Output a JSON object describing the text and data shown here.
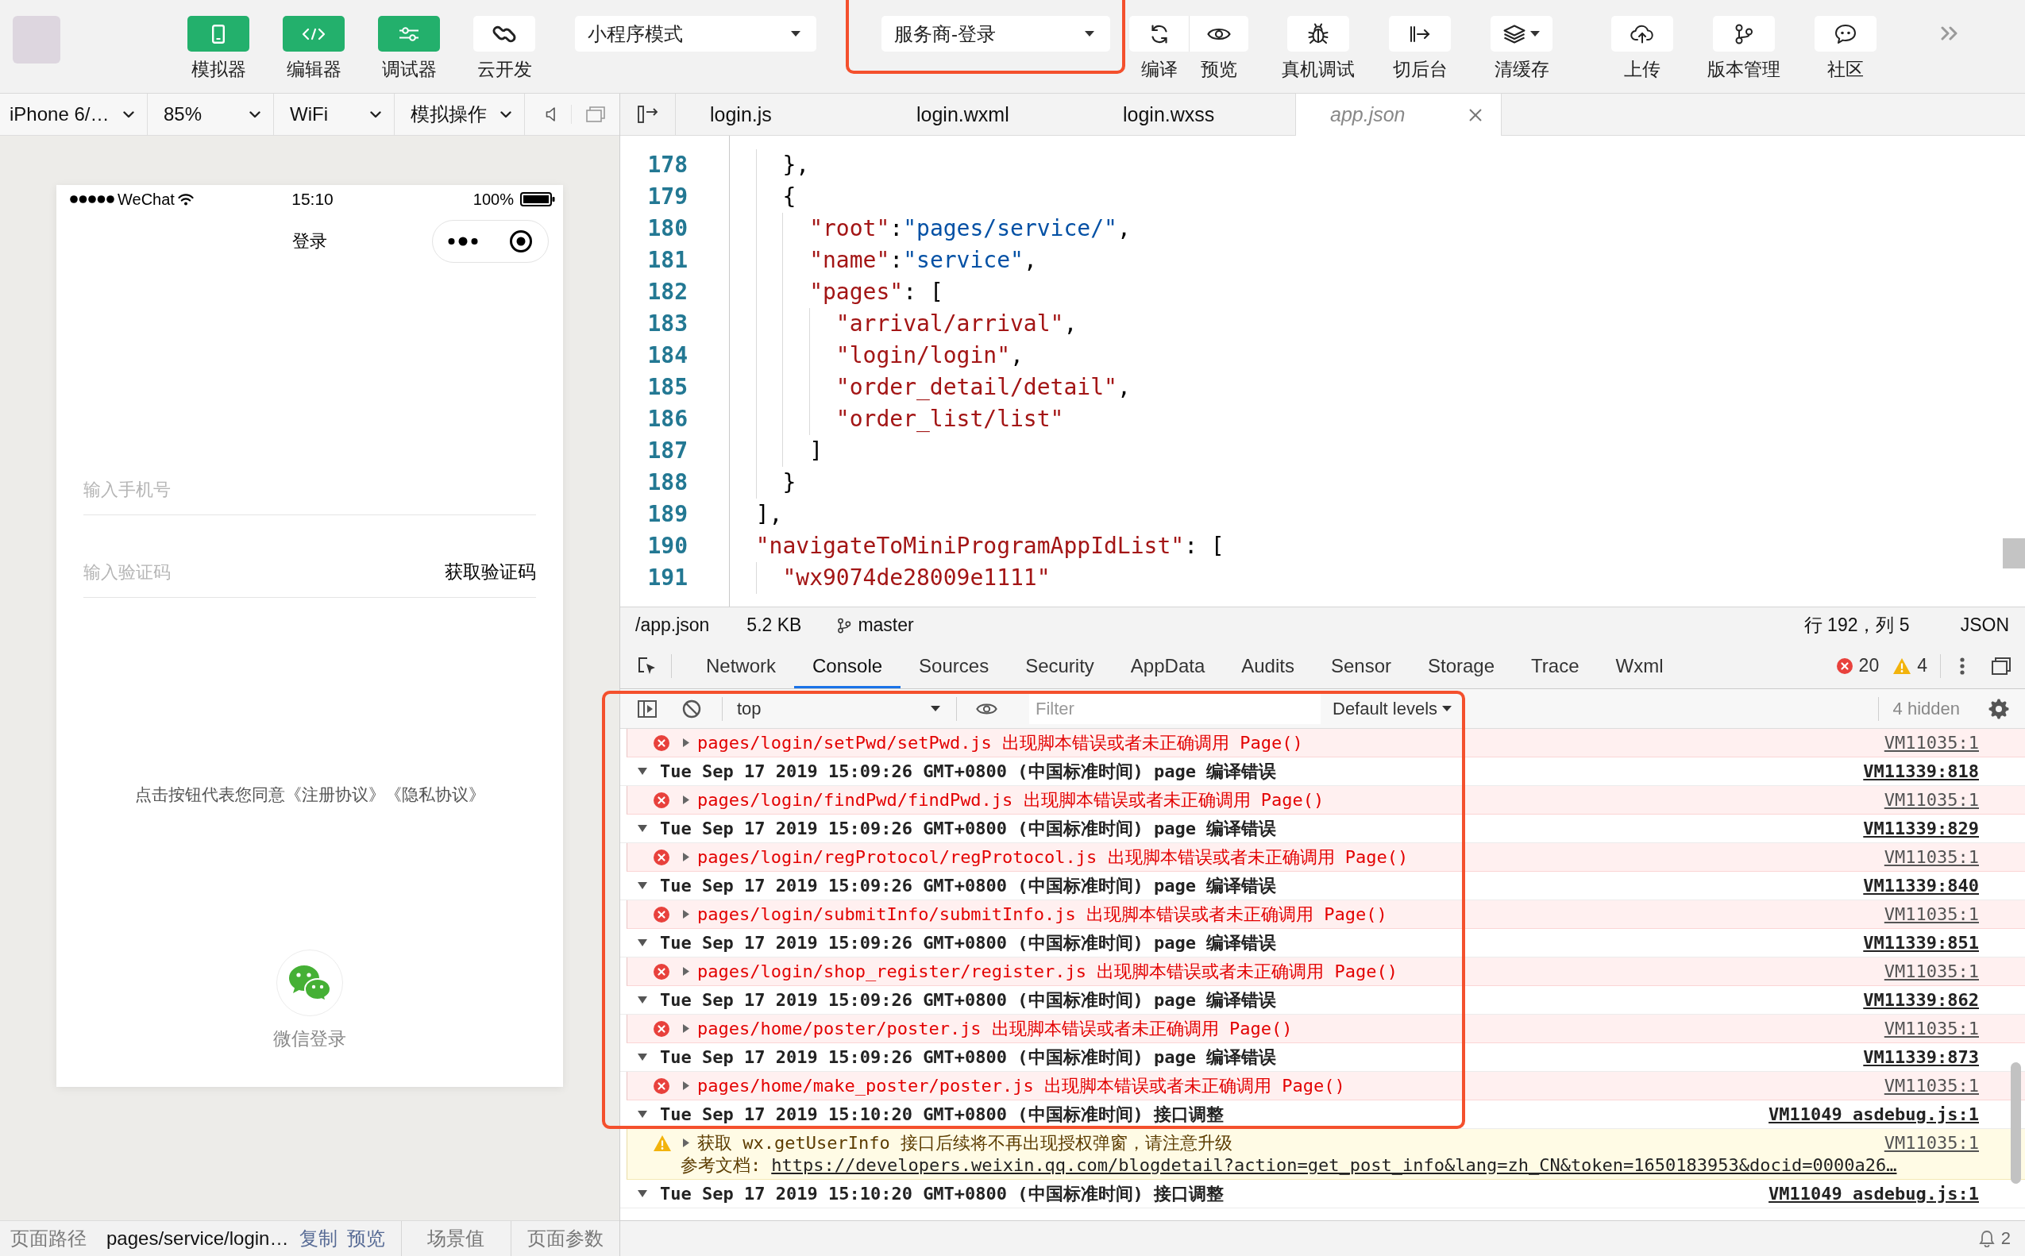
{
  "toolbar": {
    "panels": [
      {
        "label": "模拟器",
        "kind": "phone",
        "on": true
      },
      {
        "label": "编辑器",
        "kind": "code",
        "on": true
      },
      {
        "label": "调试器",
        "kind": "debug",
        "on": true
      },
      {
        "label": "云开发",
        "kind": "cloud",
        "on": false
      }
    ],
    "mode_select": {
      "value": "小程序模式"
    },
    "compile_select": {
      "value": "服务商-登录",
      "highlighted": true
    },
    "action_groups": [
      {
        "joined": true,
        "items": [
          {
            "label": "编译",
            "kind": "compile",
            "menu": false
          },
          {
            "label": "预览",
            "kind": "preview",
            "menu": false
          }
        ]
      },
      {
        "joined": false,
        "items": [
          {
            "label": "真机调试",
            "kind": "remote_debug",
            "menu": false
          },
          {
            "label": "切后台",
            "kind": "background",
            "menu": false
          },
          {
            "label": "清缓存",
            "kind": "clear_cache",
            "menu": true
          }
        ]
      },
      {
        "joined": false,
        "items": [
          {
            "label": "上传",
            "kind": "upload",
            "menu": false
          },
          {
            "label": "版本管理",
            "kind": "version",
            "menu": false
          },
          {
            "label": "社区",
            "kind": "community",
            "menu": false
          }
        ]
      }
    ]
  },
  "simulator": {
    "toolbar": {
      "device": "iPhone 6/…",
      "zoom": "85%",
      "network": "WiFi",
      "operation": "模拟操作"
    },
    "phone": {
      "status_bar": {
        "carrier": "WeChat",
        "time": "15:10",
        "battery": "100%"
      },
      "title": "登录",
      "fields": [
        {
          "placeholder": "输入手机号"
        },
        {
          "placeholder": "输入验证码",
          "action": "获取验证码"
        }
      ],
      "agreement": "点击按钮代表您同意《注册协议》《隐私协议》",
      "wechat_login": "微信登录"
    },
    "status_bar": {
      "path_label": "页面路径",
      "path": "pages/service/login…",
      "copy": "复制",
      "preview": "预览",
      "scene": "场景值",
      "params": "页面参数"
    }
  },
  "editor": {
    "tabs": [
      {
        "label": "login.js",
        "selected": false,
        "preview": false
      },
      {
        "label": "login.wxml",
        "selected": false,
        "preview": false
      },
      {
        "label": "login.wxss",
        "selected": false,
        "preview": false
      },
      {
        "label": "app.json",
        "selected": true,
        "preview": true
      }
    ],
    "lines": [
      {
        "number": "178",
        "tokens": [
          {
            "kind": "punct",
            "text": "    },"
          }
        ]
      },
      {
        "number": "179",
        "tokens": [
          {
            "kind": "punct",
            "text": "    {"
          }
        ]
      },
      {
        "number": "180",
        "tokens": [
          {
            "kind": "key",
            "text": "      \"root\""
          },
          {
            "kind": "punct",
            "text": ":"
          },
          {
            "kind": "value",
            "text": "\"pages/service/\""
          },
          {
            "kind": "punct",
            "text": ","
          }
        ]
      },
      {
        "number": "181",
        "tokens": [
          {
            "kind": "key",
            "text": "      \"name\""
          },
          {
            "kind": "punct",
            "text": ":"
          },
          {
            "kind": "value",
            "text": "\"service\""
          },
          {
            "kind": "punct",
            "text": ","
          }
        ]
      },
      {
        "number": "182",
        "tokens": [
          {
            "kind": "key",
            "text": "      \"pages\""
          },
          {
            "kind": "punct",
            "text": ": ["
          }
        ]
      },
      {
        "number": "183",
        "tokens": [
          {
            "kind": "element",
            "text": "        \"arrival/arrival\""
          },
          {
            "kind": "punct",
            "text": ","
          }
        ]
      },
      {
        "number": "184",
        "tokens": [
          {
            "kind": "element",
            "text": "        \"login/login\""
          },
          {
            "kind": "punct",
            "text": ","
          }
        ]
      },
      {
        "number": "185",
        "tokens": [
          {
            "kind": "element",
            "text": "        \"order_detail/detail\""
          },
          {
            "kind": "punct",
            "text": ","
          }
        ]
      },
      {
        "number": "186",
        "tokens": [
          {
            "kind": "element",
            "text": "        \"order_list/list\""
          }
        ]
      },
      {
        "number": "187",
        "tokens": [
          {
            "kind": "punct",
            "text": "      ]"
          }
        ]
      },
      {
        "number": "188",
        "tokens": [
          {
            "kind": "punct",
            "text": "    }"
          }
        ]
      },
      {
        "number": "189",
        "tokens": [
          {
            "kind": "punct",
            "text": "  ],"
          }
        ]
      },
      {
        "number": "190",
        "tokens": [
          {
            "kind": "key",
            "text": "  \"navigateToMiniProgramAppIdList\""
          },
          {
            "kind": "punct",
            "text": ": ["
          }
        ]
      },
      {
        "number": "191",
        "tokens": [
          {
            "kind": "element",
            "text": "    \"wx9074de28009e1111\""
          }
        ]
      }
    ],
    "status_bar": {
      "path": "/app.json",
      "size": "5.2 KB",
      "branch": "master",
      "cursor": "行 192，列 5",
      "language": "JSON"
    }
  },
  "devtools": {
    "tabs": [
      {
        "label": "Network",
        "selected": false
      },
      {
        "label": "Console",
        "selected": true
      },
      {
        "label": "Sources",
        "selected": false
      },
      {
        "label": "Security",
        "selected": false
      },
      {
        "label": "AppData",
        "selected": false
      },
      {
        "label": "Audits",
        "selected": false
      },
      {
        "label": "Sensor",
        "selected": false
      },
      {
        "label": "Storage",
        "selected": false
      },
      {
        "label": "Trace",
        "selected": false
      },
      {
        "label": "Wxml",
        "selected": false
      }
    ],
    "errors": "20",
    "warnings": "4",
    "console": {
      "highlighted": true,
      "context": "top",
      "filter_placeholder": "Filter",
      "levels": "Default levels",
      "hidden": "4 hidden",
      "messages": [
        {
          "kind": "error",
          "expanded": false,
          "text": "pages/login/setPwd/setPwd.js 出现脚本错误或者未正确调用 Page()",
          "source": "VM11035:1"
        },
        {
          "kind": "group",
          "expanded": true,
          "text": "Tue Sep 17 2019 15:09:26 GMT+0800 (中国标准时间) page 编译错误",
          "source": "VM11339:818",
          "children": [
            {
              "kind": "error",
              "expanded": false,
              "text": "pages/login/findPwd/findPwd.js 出现脚本错误或者未正确调用 Page()",
              "source": "VM11035:1"
            }
          ]
        },
        {
          "kind": "group",
          "expanded": true,
          "text": "Tue Sep 17 2019 15:09:26 GMT+0800 (中国标准时间) page 编译错误",
          "source": "VM11339:829",
          "children": [
            {
              "kind": "error",
              "expanded": false,
              "text": "pages/login/regProtocol/regProtocol.js 出现脚本错误或者未正确调用 Page()",
              "source": "VM11035:1"
            }
          ]
        },
        {
          "kind": "group",
          "expanded": true,
          "text": "Tue Sep 17 2019 15:09:26 GMT+0800 (中国标准时间) page 编译错误",
          "source": "VM11339:840",
          "children": [
            {
              "kind": "error",
              "expanded": false,
              "text": "pages/login/submitInfo/submitInfo.js 出现脚本错误或者未正确调用 Page()",
              "source": "VM11035:1"
            }
          ]
        },
        {
          "kind": "group",
          "expanded": true,
          "text": "Tue Sep 17 2019 15:09:26 GMT+0800 (中国标准时间) page 编译错误",
          "source": "VM11339:851",
          "children": [
            {
              "kind": "error",
              "expanded": false,
              "text": "pages/login/shop_register/register.js 出现脚本错误或者未正确调用 Page()",
              "source": "VM11035:1"
            }
          ]
        },
        {
          "kind": "group",
          "expanded": true,
          "text": "Tue Sep 17 2019 15:09:26 GMT+0800 (中国标准时间) page 编译错误",
          "source": "VM11339:862",
          "children": [
            {
              "kind": "error",
              "expanded": false,
              "text": "pages/home/poster/poster.js 出现脚本错误或者未正确调用 Page()",
              "source": "VM11035:1"
            }
          ]
        },
        {
          "kind": "group",
          "expanded": true,
          "text": "Tue Sep 17 2019 15:09:26 GMT+0800 (中国标准时间) page 编译错误",
          "source": "VM11339:873",
          "children": [
            {
              "kind": "error",
              "expanded": false,
              "text": "pages/home/make_poster/poster.js 出现脚本错误或者未正确调用 Page()",
              "source": "VM11035:1"
            }
          ]
        },
        {
          "kind": "group",
          "expanded": true,
          "text": "Tue Sep 17 2019 15:10:20 GMT+0800 (中国标准时间) 接口调整",
          "source": "VM11049 asdebug.js:1",
          "children": [
            {
              "kind": "warning",
              "expanded": false,
              "text": "获取 wx.getUserInfo 接口后续将不再出现授权弹窗，请注意升级",
              "source": "VM11035:1",
              "note_label": "参考文档:",
              "note_link": "https://developers.weixin.qq.com/blogdetail?action=get_post_info&lang=zh_CN&token=1650183953&docid=0000a26…"
            }
          ]
        },
        {
          "kind": "group",
          "expanded": true,
          "text": "Tue Sep 17 2019 15:10:20 GMT+0800 (中国标准时间) 接口调整",
          "source": "VM11049 asdebug.js:1"
        }
      ]
    },
    "notifications": "2"
  }
}
